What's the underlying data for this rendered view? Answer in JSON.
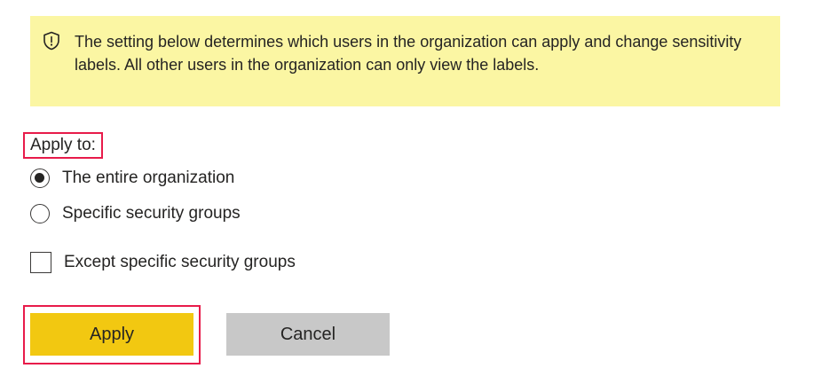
{
  "banner": {
    "icon": "shield-icon",
    "text": "The setting below determines which users in the organization can apply and change sensitivity labels. All other users in the organization can only view the labels.",
    "background": "#fbf6a3"
  },
  "apply_to": {
    "label": "Apply to:",
    "options": [
      {
        "label": "The entire organization",
        "selected": true
      },
      {
        "label": "Specific security groups",
        "selected": false
      }
    ]
  },
  "except": {
    "label": "Except specific security groups",
    "checked": false
  },
  "buttons": {
    "apply_label": "Apply",
    "cancel_label": "Cancel",
    "apply_color": "#f2c811",
    "cancel_color": "#c8c8c8"
  },
  "highlight_color": "#e81b4a"
}
